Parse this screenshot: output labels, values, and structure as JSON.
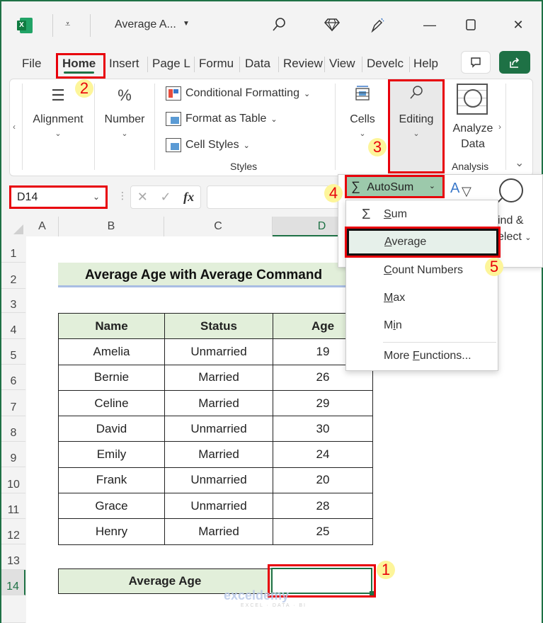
{
  "window": {
    "title": "Average A...",
    "icons": [
      "excel-logo",
      "quick-access-customize-icon",
      "search-icon",
      "premium-diamond-icon",
      "pen-icon",
      "minimize-icon",
      "maximize-icon",
      "close-icon"
    ]
  },
  "tabs": [
    "File",
    "Home",
    "Insert",
    "Page L",
    "Formu",
    "Data",
    "Review",
    "View",
    "Develc",
    "Help"
  ],
  "active_tab": "Home",
  "ribbon": {
    "alignment": "Alignment",
    "number": "Number",
    "styles": {
      "conditional_formatting": "Conditional Formatting",
      "format_as_table": "Format as Table",
      "cell_styles": "Cell Styles",
      "group_label": "Styles"
    },
    "cells": "Cells",
    "editing": "Editing",
    "analyze_data_1": "Analyze",
    "analyze_data_2": "Data",
    "analysis_label": "Analysis"
  },
  "formula_bar": {
    "name_box": "D14",
    "formula": ""
  },
  "columns": [
    "A",
    "B",
    "C",
    "D"
  ],
  "selected_column": "D",
  "rows": [
    "1",
    "2",
    "3",
    "4",
    "5",
    "6",
    "7",
    "8",
    "9",
    "10",
    "11",
    "12",
    "13",
    "14"
  ],
  "selected_row": "14",
  "sheet": {
    "title": "Average Age with Average Command",
    "headers": [
      "Name",
      "Status",
      "Age"
    ],
    "records": [
      [
        "Amelia",
        "Unmarried",
        "19"
      ],
      [
        "Bernie",
        "Married",
        "26"
      ],
      [
        "Celine",
        "Married",
        "29"
      ],
      [
        "David",
        "Unmarried",
        "30"
      ],
      [
        "Emily",
        "Married",
        "24"
      ],
      [
        "Frank",
        "Unmarried",
        "20"
      ],
      [
        "Grace",
        "Unmarried",
        "28"
      ],
      [
        "Henry",
        "Married",
        "25"
      ]
    ],
    "average_label": "Average Age",
    "average_value": ""
  },
  "editing_panel": {
    "autosum": "AutoSum",
    "find_select_1": "ind &",
    "find_select_2": "elect",
    "menu": [
      {
        "pre": "",
        "u": "S",
        "post": "um",
        "icon": "Σ"
      },
      {
        "pre": "",
        "u": "A",
        "post": "verage",
        "icon": ""
      },
      {
        "pre": "",
        "u": "C",
        "post": "ount Numbers",
        "icon": ""
      },
      {
        "pre": "",
        "u": "M",
        "post": "ax",
        "icon": ""
      },
      {
        "pre": "M",
        "u": "i",
        "post": "n",
        "icon": ""
      },
      {
        "pre": "More ",
        "u": "F",
        "post": "unctions...",
        "icon": ""
      }
    ],
    "highlighted": "Average"
  },
  "step_badges": [
    "1",
    "2",
    "3",
    "4",
    "5"
  ],
  "watermark": {
    "brand": "exceldemy",
    "tagline": "EXCEL · DATA · BI"
  },
  "colors": {
    "accent": "#1e7145",
    "highlight_red": "#e8000b",
    "header_fill": "#e2efda",
    "badge_fill": "#fdf59a"
  }
}
